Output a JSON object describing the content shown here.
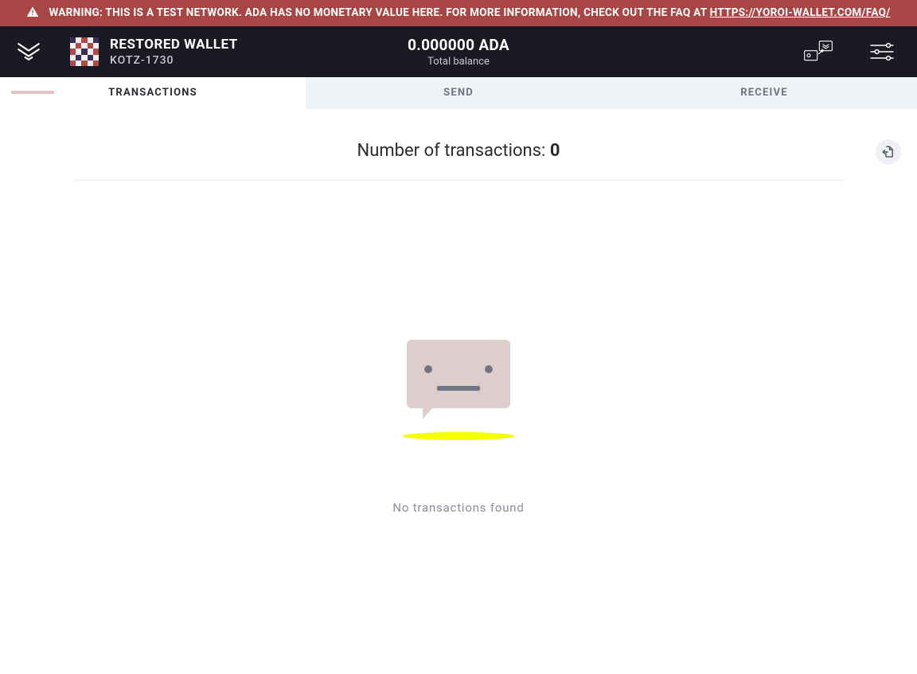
{
  "warning": {
    "prefix": "WARNING: THIS IS A TEST NETWORK. ADA HAS NO MONETARY VALUE HERE. FOR MORE INFORMATION, CHECK OUT THE FAQ AT ",
    "link_text": "HTTPS://YOROI-WALLET.COM/FAQ/"
  },
  "header": {
    "wallet_name": "RESTORED WALLET",
    "wallet_id": "KOTZ-1730",
    "balance": "0.000000 ADA",
    "balance_label": "Total balance"
  },
  "tabs": {
    "transactions": "TRANSACTIONS",
    "send": "SEND",
    "receive": "RECEIVE"
  },
  "body": {
    "tx_count_label": "Number of transactions: ",
    "tx_count_value": "0",
    "empty_text": "No transactions found"
  },
  "icons": {
    "warning": "warning-triangle-icon",
    "brand": "yoroi-logo-icon",
    "transfer": "transfer-icon",
    "settings": "settings-sliders-icon",
    "export": "file-export-icon"
  },
  "colors": {
    "warn_bg": "#A84545",
    "header_bg": "#1A1A24",
    "tab_bg": "#F0F3F5",
    "muted": "#6B7384",
    "bubble": "#DCCECC",
    "accent_yellow": "#F4FF00"
  }
}
